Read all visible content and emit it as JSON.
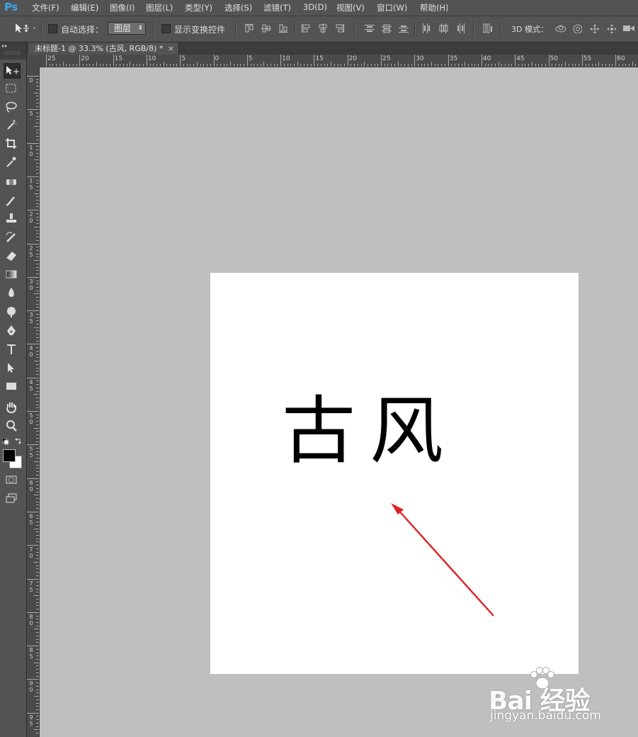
{
  "app": {
    "logo": "Ps"
  },
  "menu": [
    {
      "label": "文件(F)"
    },
    {
      "label": "编辑(E)"
    },
    {
      "label": "图像(I)"
    },
    {
      "label": "图层(L)"
    },
    {
      "label": "类型(Y)"
    },
    {
      "label": "选择(S)"
    },
    {
      "label": "滤镜(T)"
    },
    {
      "label": "3D(D)"
    },
    {
      "label": "视图(V)"
    },
    {
      "label": "窗口(W)"
    },
    {
      "label": "帮助(H)"
    }
  ],
  "options": {
    "auto_select_label": "自动选择：",
    "auto_select_checked": false,
    "auto_select_value": "图层",
    "show_transform_label": "显示变换控件",
    "show_transform_checked": false,
    "mode3d_label": "3D 模式："
  },
  "document": {
    "tab_title": "未标题-1 @ 33.3% (古风, RGB/8) *",
    "close_glyph": "×",
    "text_layer": "古风"
  },
  "ruler": {
    "h_labels": [
      "25",
      "20",
      "15",
      "10",
      "5",
      "0",
      "5",
      "10",
      "15",
      "20",
      "25",
      "30",
      "35",
      "40",
      "45",
      "50",
      "55",
      "60"
    ],
    "v_labels": [
      "0",
      "5",
      "10",
      "15",
      "20",
      "25",
      "30",
      "35",
      "40",
      "45",
      "50",
      "55",
      "60",
      "65",
      "70",
      "75",
      "80",
      "85",
      "90",
      "95",
      "100",
      "105",
      "110",
      "115",
      "120",
      "125",
      "130",
      "135",
      "140"
    ]
  },
  "colors": {
    "foreground": "#000000",
    "background": "#ffffff",
    "annotation_arrow": "#e02020"
  },
  "watermark": {
    "main": "Bai 经验",
    "sub": "jingyan.baidu.com"
  }
}
